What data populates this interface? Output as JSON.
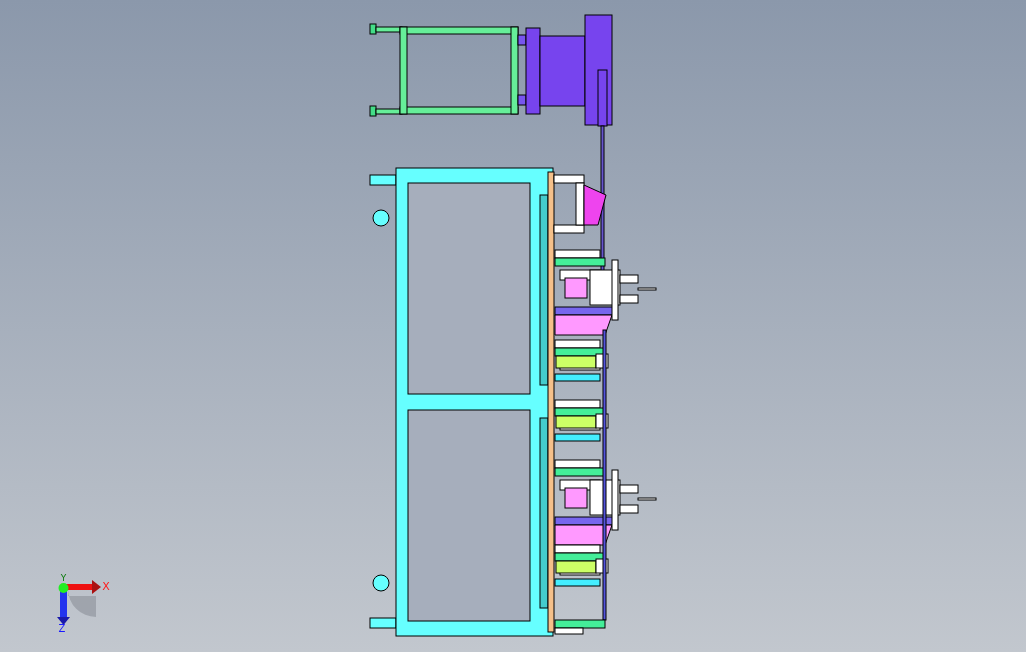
{
  "viewport": {
    "axes": [
      {
        "kind": "y",
        "label": "Y"
      },
      {
        "kind": "x",
        "label": "X"
      },
      {
        "kind": "z",
        "label": "Z"
      }
    ]
  }
}
